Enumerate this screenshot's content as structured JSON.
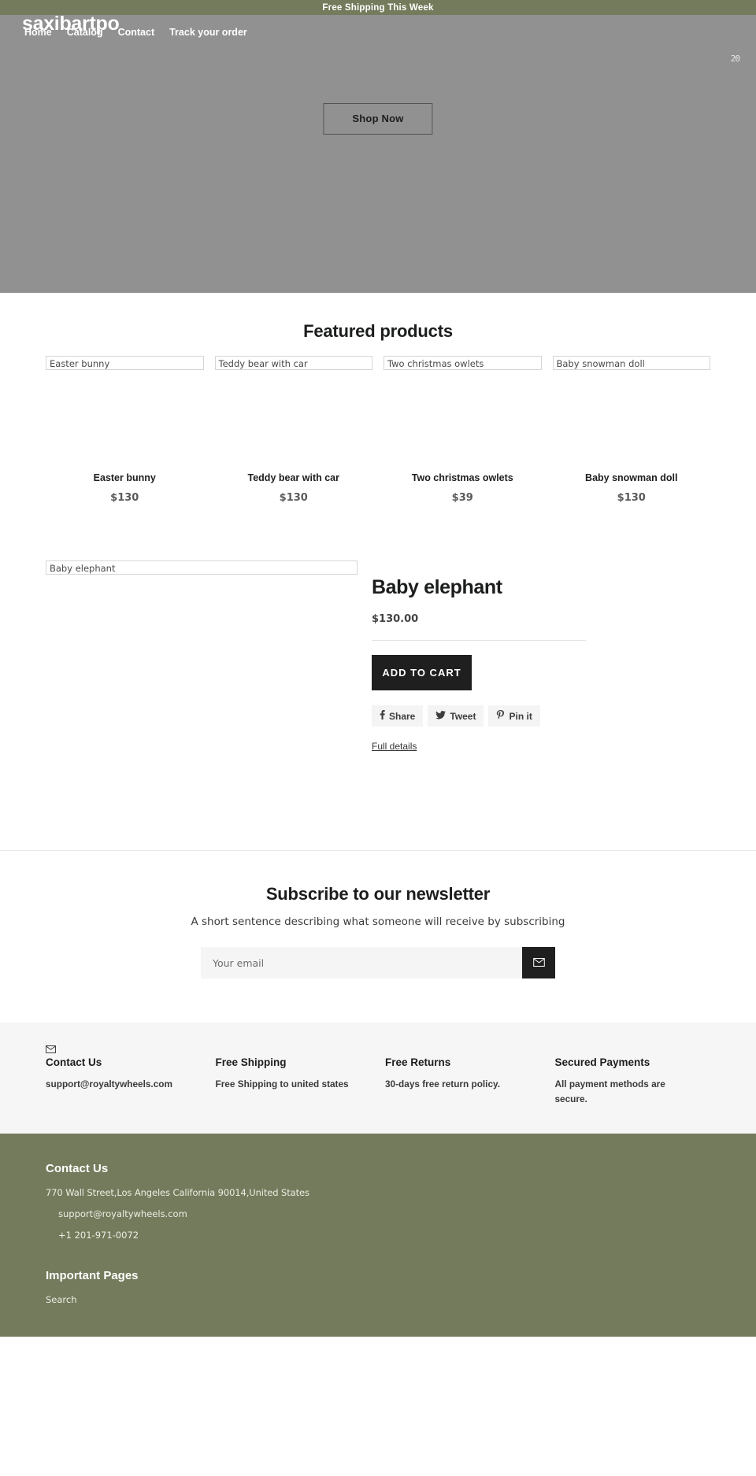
{
  "announcement": {
    "text": "Free Shipping This Week"
  },
  "header": {
    "logo": "saxibartpo",
    "nav": [
      {
        "label": "Home"
      },
      {
        "label": "Catalog"
      },
      {
        "label": "Contact"
      },
      {
        "label": "Track your order"
      }
    ],
    "cart_count": "20"
  },
  "hero": {
    "cta_label": "Shop Now"
  },
  "featured": {
    "title": "Featured products",
    "products": [
      {
        "alt": "Easter bunny",
        "name": "Easter bunny",
        "price": "$130"
      },
      {
        "alt": "Teddy bear with car",
        "name": "Teddy bear with car",
        "price": "$130"
      },
      {
        "alt": "Two christmas owlets",
        "name": "Two christmas owlets",
        "price": "$39"
      },
      {
        "alt": "Baby snowman doll",
        "name": "Baby snowman doll",
        "price": "$130"
      }
    ]
  },
  "detail": {
    "image_alt": "Baby elephant",
    "title": "Baby elephant",
    "price": "$130.00",
    "add_to_cart": "ADD TO CART",
    "share": [
      {
        "icon": "facebook-icon",
        "glyph": "f",
        "label": "Share"
      },
      {
        "icon": "twitter-icon",
        "glyph": "ᴠ",
        "label": "Tweet"
      },
      {
        "icon": "pinterest-icon",
        "glyph": "℗",
        "label": "Pin it"
      }
    ],
    "full_details": "Full details "
  },
  "newsletter": {
    "title": "Subscribe to our newsletter",
    "subtitle": "A short sentence describing what someone will receive by subscribing",
    "placeholder": "Your email",
    "submit_icon": "envelope-icon"
  },
  "features": [
    {
      "icon": "envelope-icon",
      "title": "Contact Us",
      "text": "support@royaltywheels.com"
    },
    {
      "icon": "",
      "title": "Free Shipping",
      "text": "Free Shipping to united states"
    },
    {
      "icon": "",
      "title": "Free Returns",
      "text": "30-days free return policy."
    },
    {
      "icon": "",
      "title": "Secured Payments",
      "text": "All payment methods are secure."
    }
  ],
  "footer": {
    "contact_title": "Contact Us",
    "address": "770 Wall Street,Los Angeles California 90014,United States",
    "email": "support@royaltywheels.com",
    "phone": "+1 201-971-0072",
    "pages_title": "Important Pages",
    "pages": [
      {
        "label": "Search"
      }
    ]
  },
  "colors": {
    "brand_olive": "#747b5c",
    "hero_gray": "#919191",
    "dark_button": "#1f1f1f",
    "feature_bg": "#f6f6f6"
  }
}
